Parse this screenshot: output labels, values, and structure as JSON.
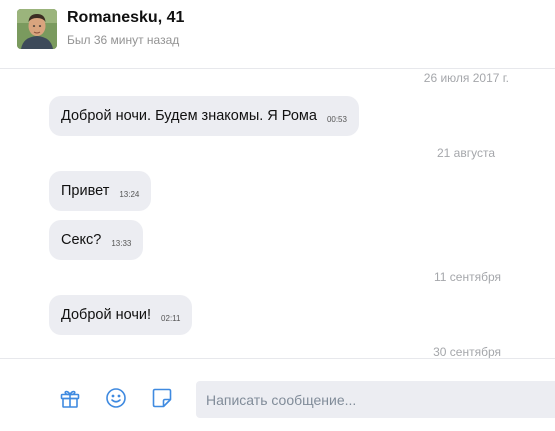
{
  "header": {
    "contact_name": "Romanesku, 41",
    "last_seen": "Был 36 минут назад"
  },
  "conversation": {
    "dates": [
      "26 июля 2017 г.",
      "21 августа",
      "11 сентября",
      "30 сентября"
    ],
    "messages": [
      {
        "text": "Доброй ночи. Будем знакомы. Я Рома",
        "time": "00:53"
      },
      {
        "text": "Привет",
        "time": "13:24"
      },
      {
        "text": "Секс?",
        "time": "13:33"
      },
      {
        "text": "Доброй ночи!",
        "time": "02:11"
      }
    ]
  },
  "composer": {
    "placeholder": "Написать сообщение...",
    "icons": [
      "gift-icon",
      "smile-icon",
      "sticker-icon"
    ],
    "icon_color": "#3f8ae0"
  },
  "colors": {
    "bubble_background": "#ecedf2",
    "divider": "#e7e8ec",
    "muted_text": "#a5a7ab"
  }
}
